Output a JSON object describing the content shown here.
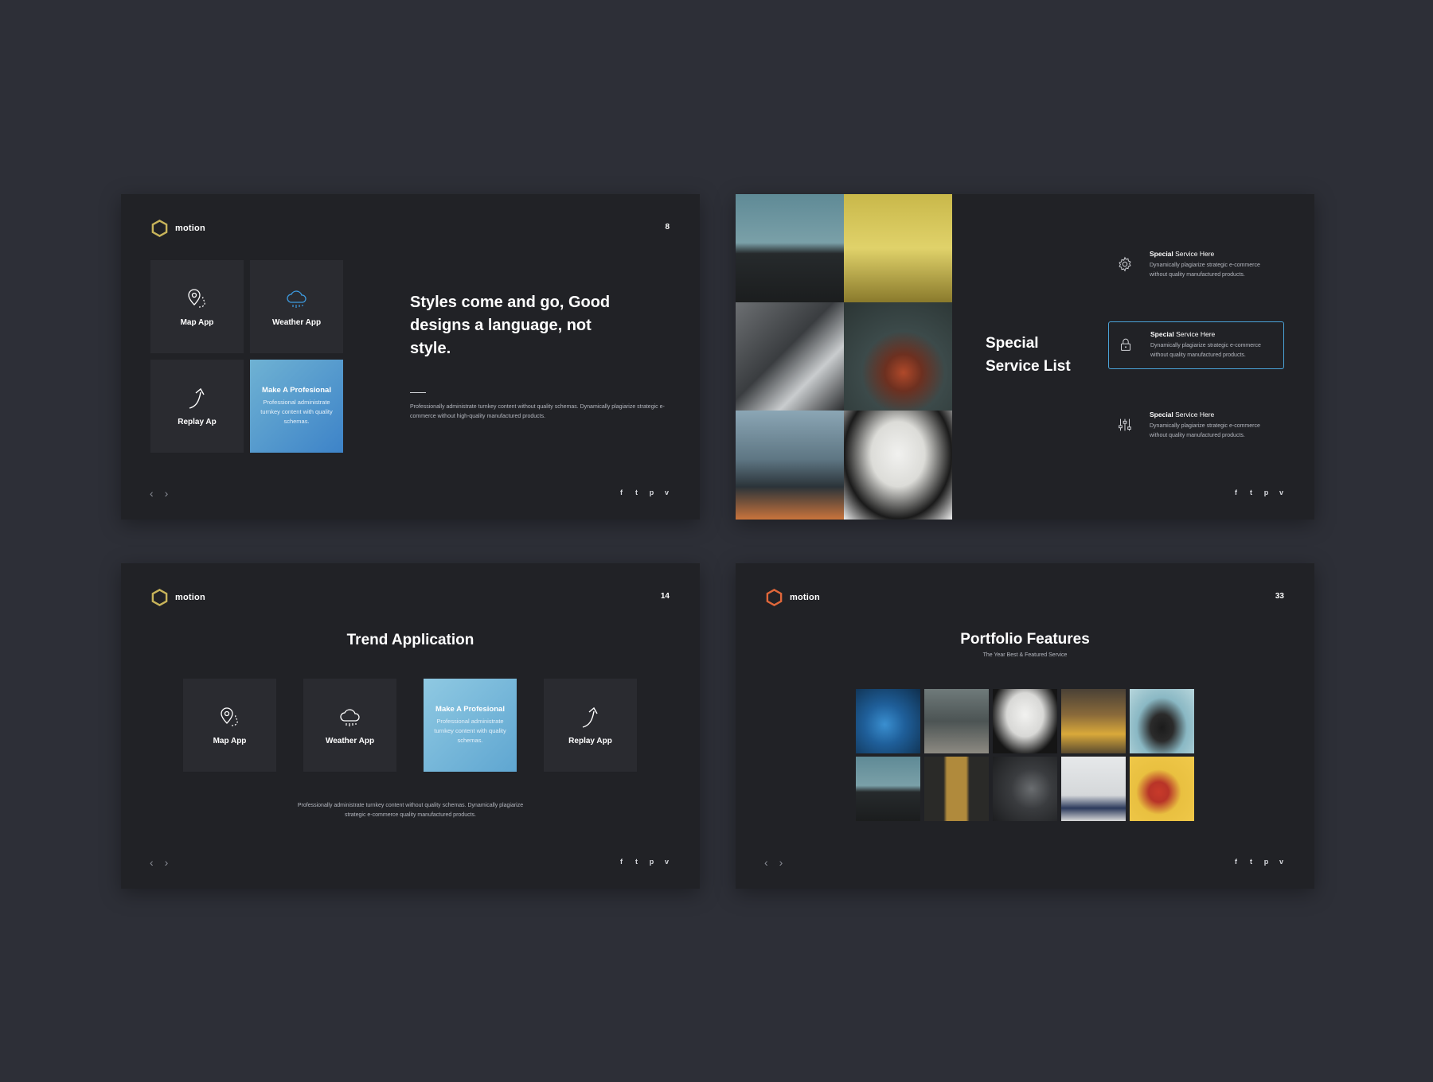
{
  "colors": {
    "background": "#2d2f37",
    "slide": "#212226",
    "tile": "#2a2b30",
    "accent_blue": "#3d83c8",
    "logo_gold": "#c8b45a",
    "logo_orange": "#e0673a"
  },
  "slide1": {
    "brand": "motion",
    "page": "8",
    "tiles": [
      {
        "label": "Map App",
        "icon": "map-pin-icon"
      },
      {
        "label": "Weather App",
        "icon": "cloud-rain-icon"
      },
      {
        "label": "Replay Ap",
        "icon": "arrow-up-icon"
      }
    ],
    "highlight": {
      "title": "Make A Profesional",
      "text": "Professional administrate turnkey content with quality schemas."
    },
    "quote": "Styles come and go, Good designs a language, not style.",
    "description": "Professionally administrate turnkey content without quality schemas. Dynamically plagiarize strategic e-commerce without high-quality manufactured products.",
    "nav": {
      "prev": "‹",
      "next": "›"
    },
    "social": [
      "f",
      "t",
      "p",
      "v"
    ]
  },
  "slide2": {
    "title": "Special Service List",
    "services": [
      {
        "title_bold": "Special",
        "title_rest": " Service Here",
        "desc": "Dynamically plagiarize strategic e-commerce without quality manufactured products.",
        "icon": "gear-icon",
        "active": false
      },
      {
        "title_bold": "Special",
        "title_rest": " Service Here",
        "desc": "Dynamically plagiarize strategic e-commerce without quality manufactured products.",
        "icon": "lock-icon",
        "active": true
      },
      {
        "title_bold": "Special",
        "title_rest": " Service Here",
        "desc": "Dynamically plagiarize strategic e-commerce without quality manufactured products.",
        "icon": "sliders-icon",
        "active": false
      }
    ],
    "social": [
      "f",
      "t",
      "p",
      "v"
    ]
  },
  "slide3": {
    "brand": "motion",
    "page": "14",
    "title": "Trend Application",
    "tiles": [
      {
        "label": "Map App",
        "icon": "map-pin-icon"
      },
      {
        "label": "Weather App",
        "icon": "cloud-rain-icon"
      },
      {
        "label": "Replay App",
        "icon": "arrow-up-icon"
      }
    ],
    "highlight": {
      "title": "Make A Profesional",
      "text": "Professional administrate turnkey content with quality schemas."
    },
    "description": "Professionally administrate turnkey content without quality schemas. Dynamically plagiarize strategic e-commerce quality manufactured products.",
    "nav": {
      "prev": "‹",
      "next": "›"
    },
    "social": [
      "f",
      "t",
      "p",
      "v"
    ]
  },
  "slide4": {
    "brand": "motion",
    "page": "33",
    "title": "Portfolio Features",
    "subtitle": "The Year Best & Featured Service",
    "nav": {
      "prev": "‹",
      "next": "›"
    },
    "social": [
      "f",
      "t",
      "p",
      "v"
    ]
  }
}
